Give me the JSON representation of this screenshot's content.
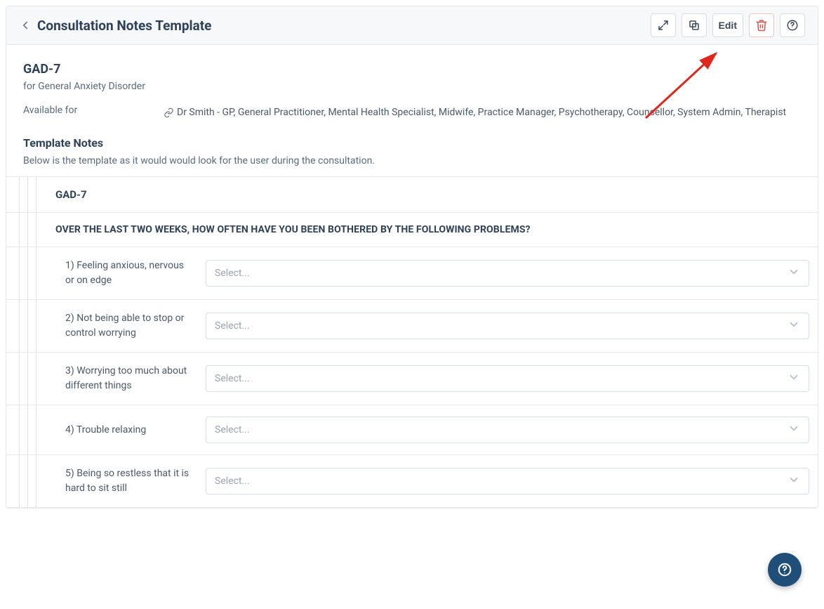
{
  "header": {
    "title": "Consultation Notes Template",
    "actions": {
      "edit_label": "Edit"
    }
  },
  "template": {
    "name": "GAD-7",
    "description": "for General Anxiety Disorder",
    "available_for_label": "Available for",
    "available_for": [
      "Dr Smith - GP",
      "General Practitioner",
      "Mental Health Specialist",
      "Midwife",
      "Practice Manager",
      "Psychotherapy, Counsellor",
      "System Admin",
      "Therapist"
    ]
  },
  "notes_section": {
    "title": "Template Notes",
    "description": "Below is the template as it would would look for the user during the consultation."
  },
  "form": {
    "heading": "GAD-7",
    "prompt": "OVER THE LAST TWO WEEKS, HOW OFTEN HAVE YOU BEEN BOTHERED BY THE FOLLOWING PROBLEMS?",
    "select_placeholder": "Select...",
    "questions": [
      {
        "label": "1) Feeling anxious, nervous or on edge"
      },
      {
        "label": "2) Not being able to stop or control worrying"
      },
      {
        "label": "3) Worrying too much about different things"
      },
      {
        "label": "4) Trouble relaxing"
      },
      {
        "label": "5) Being so restless that it is hard to sit still"
      }
    ]
  }
}
